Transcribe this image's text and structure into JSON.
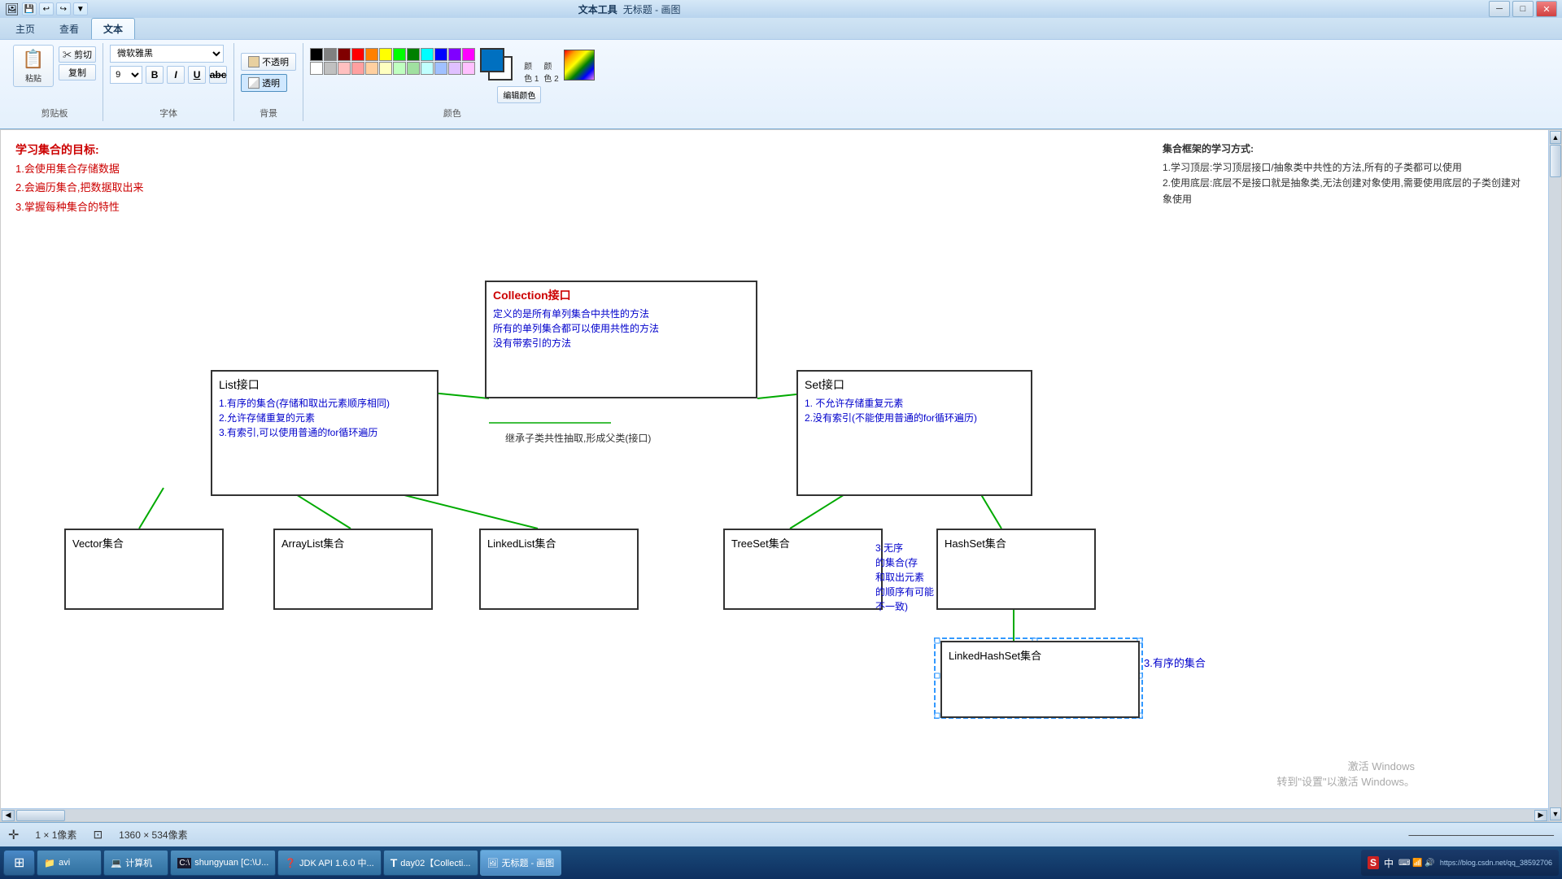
{
  "window": {
    "title": "无标题 - 画图",
    "app_name": "文本工具",
    "min_label": "─",
    "max_label": "□",
    "close_label": "✕"
  },
  "quick_access": {
    "items": [
      "💾",
      "↩",
      "↪",
      "▼"
    ]
  },
  "ribbon": {
    "tabs": [
      {
        "label": "主页",
        "active": false
      },
      {
        "label": "查看",
        "active": false
      },
      {
        "label": "文本",
        "active": true
      }
    ],
    "clipboard": {
      "paste_label": "粘贴",
      "cut_label": "✂ 剪切",
      "copy_label": "复制"
    },
    "font": {
      "name": "微软雅黑",
      "size": "9",
      "bold": "B",
      "italic": "I",
      "underline": "U",
      "strikethrough": "abc"
    },
    "background": {
      "opaque_label": "不透明",
      "transparent_label": "透明"
    },
    "sections": {
      "clipboard_label": "剪贴板",
      "font_label": "字体",
      "background_label": "背景",
      "color_label": "颜色"
    },
    "color1_label": "颜\n色 1",
    "color2_label": "颜\n色 2",
    "edit_color_label": "编辑颜色"
  },
  "diagram": {
    "title_text": "学习集合的目标:",
    "goals": [
      "1.会使用集合存储数据",
      "2.会遍历集合,把数据取出来",
      "3.掌握每种集合的特性"
    ],
    "right_notes": {
      "title": "集合框架的学习方式:",
      "items": [
        "1.学习顶层:学习顶层接口/抽象类中共性的方法,所有的子类都可以使用",
        "2.使用底层:底层不是接口就是抽象类,无法创建对象使用,需要使用底层的子类创建对象使用"
      ]
    },
    "inherit_label": "继承子类共性抽取,形成父类(接口)",
    "collection_node": {
      "title": "Collection接口",
      "lines": [
        "定义的是所有单列集合中共性的方法",
        "所有的单列集合都可以使用共性的方法",
        "没有带索引的方法"
      ]
    },
    "list_node": {
      "title": "List接口",
      "lines": [
        "1.有序的集合(存储和取出元素顺序相同)",
        "2.允许存储重复的元素",
        "3.有索引,可以使用普通的for循环遍历"
      ]
    },
    "set_node": {
      "title": "Set接口",
      "lines": [
        "1. 不允许存储重复元素",
        "2.没有索引(不能使用普通的for循环遍历)"
      ]
    },
    "vector_node": {
      "title": "Vector集合"
    },
    "arraylist_node": {
      "title": "ArrayList集合"
    },
    "linkedlist_node": {
      "title": "LinkedList集合"
    },
    "treeset_node": {
      "title": "TreeSet集合"
    },
    "hashset_node": {
      "title": "HashSet集合"
    },
    "linkedhashset_node": {
      "title": "LinkedHashSet集合"
    },
    "hashset_note": {
      "lines": [
        "3.无序",
        "的集合(存",
        "和取出元素",
        "的顺序有可能",
        "不一致)"
      ]
    },
    "linkedhashset_note": "3.有序的集合"
  },
  "statusbar": {
    "cursor_icon": "✛",
    "cursor_label": "1 × 1像素",
    "size_icon": "⊡",
    "size_label": "1360 × 534像素"
  },
  "taskbar": {
    "start_label": "⊞",
    "items": [
      {
        "label": "avi",
        "icon": "📁",
        "active": false
      },
      {
        "label": "计算机",
        "icon": "💻",
        "active": false
      },
      {
        "label": "shungyuan [C:\\U...",
        "icon": "⬛",
        "active": false
      },
      {
        "label": "JDK API 1.6.0 中...",
        "icon": "❓",
        "active": false
      },
      {
        "label": "day02【Collecti...",
        "icon": "T",
        "active": false
      },
      {
        "label": "无标题 - 画图",
        "icon": "🖼",
        "active": true
      }
    ],
    "tray": {
      "lang": "中",
      "ime": "S",
      "time": "https://blog.csdn.net/qq_38592706"
    },
    "watermark_line1": "激活 Windows",
    "watermark_line2": "转到\"设置\"以激活 Windows。"
  }
}
